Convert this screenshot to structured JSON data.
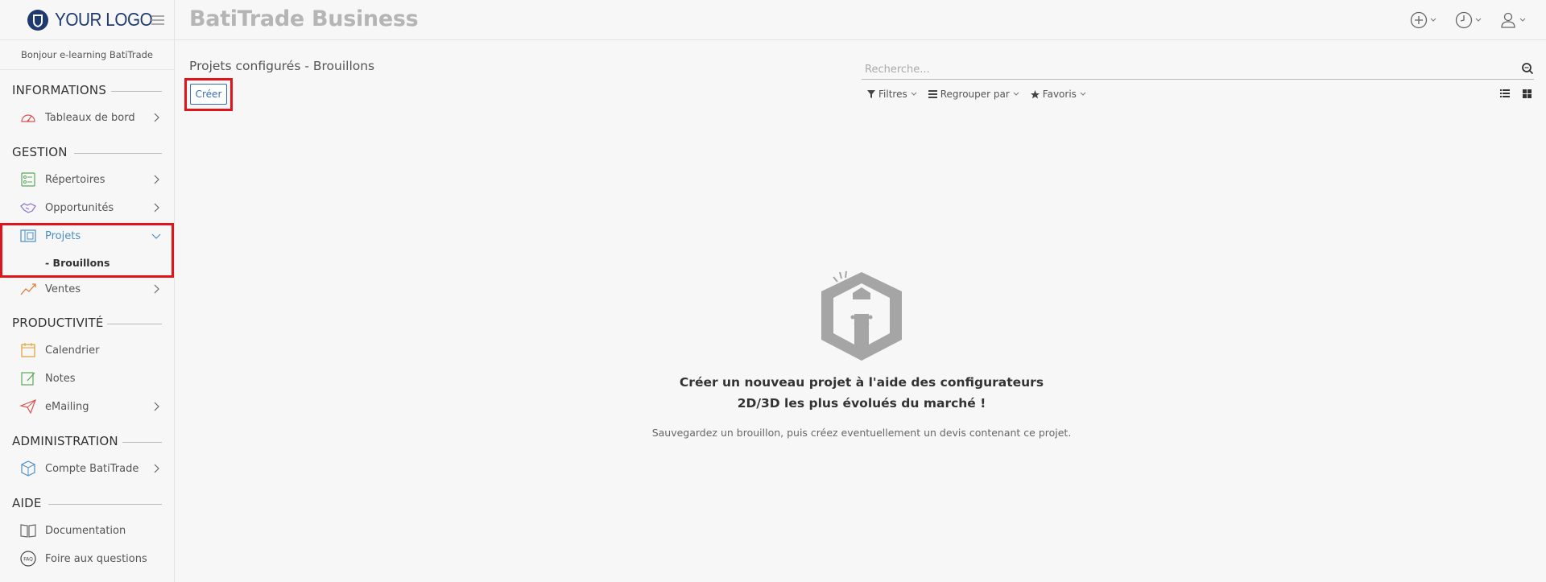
{
  "sidebar": {
    "logo_text": "YOUR LOGO",
    "greeting": "Bonjour e-learning BatiTrade",
    "sections": {
      "informations": "INFORMATIONS",
      "gestion": "GESTION",
      "productivite": "PRODUCTIVITÉ",
      "administration": "ADMINISTRATION",
      "aide": "AIDE"
    },
    "items": {
      "tableaux": "Tableaux de bord",
      "repertoires": "Répertoires",
      "opportunites": "Opportunités",
      "projets": "Projets",
      "brouillons": "- Brouillons",
      "ventes": "Ventes",
      "calendrier": "Calendrier",
      "notes": "Notes",
      "emailing": "eMailing",
      "compte": "Compte BatiTrade",
      "documentation": "Documentation",
      "faq": "Foire aux questions"
    }
  },
  "header": {
    "app_title": "BatiTrade Business"
  },
  "main": {
    "page_title": "Projets configurés - Brouillons",
    "create_label": "Créer",
    "search_placeholder": "Recherche...",
    "filters": {
      "filtres": "Filtres",
      "regrouper": "Regrouper par",
      "favoris": "Favoris"
    },
    "empty_state": {
      "heading_line1": "Créer un nouveau projet à l'aide des configurateurs",
      "heading_line2": "2D/3D les plus évolués du marché !",
      "subtext": "Sauvegardez un brouillon, puis créez eventuellement un devis contenant ce projet."
    }
  },
  "colors": {
    "brand": "#1e3a6e",
    "accent": "#4b8fc5",
    "highlight": "#e0141b"
  }
}
